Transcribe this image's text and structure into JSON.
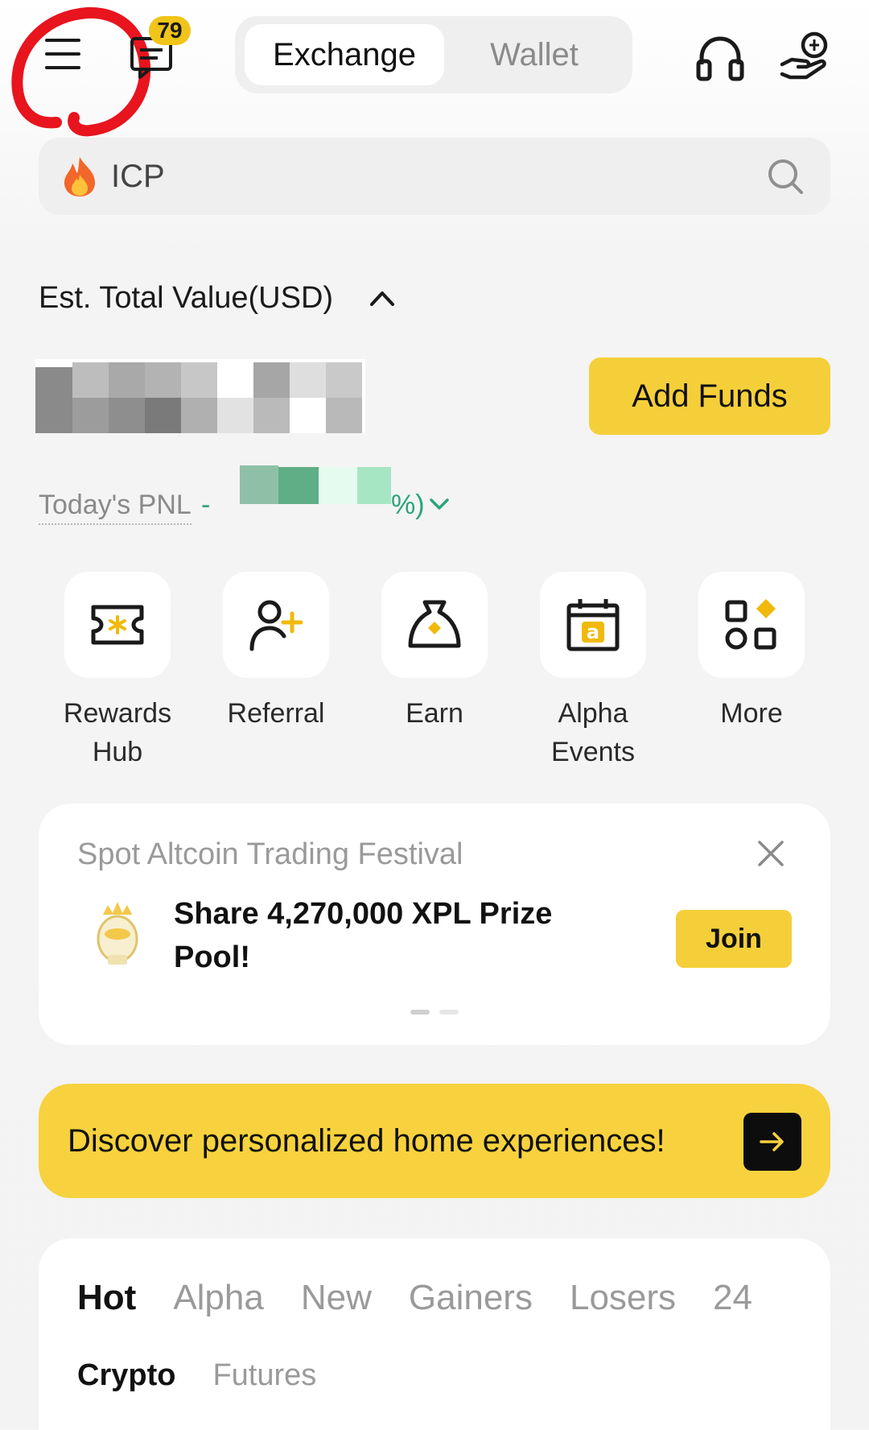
{
  "header": {
    "messages_badge": "79",
    "tabs": [
      {
        "label": "Exchange",
        "active": true
      },
      {
        "label": "Wallet",
        "active": false
      }
    ]
  },
  "search": {
    "placeholder": "ICP",
    "leading_icon": "fire-icon",
    "trailing_icon": "search-icon"
  },
  "portfolio": {
    "total_label": "Est. Total Value(USD)",
    "total_value_hidden": true,
    "add_funds_label": "Add Funds",
    "pnl_label": "Today's PNL",
    "pnl_prefix": "-",
    "pnl_suffix": "%)",
    "pnl_value_hidden": true,
    "pnl_color": "#2aa57a"
  },
  "shortcuts": [
    {
      "label": "Rewards Hub",
      "icon": "ticket-icon"
    },
    {
      "label": "Referral",
      "icon": "add-person-icon"
    },
    {
      "label": "Earn",
      "icon": "money-bag-icon"
    },
    {
      "label": "Alpha Events",
      "icon": "calendar-icon"
    },
    {
      "label": "More",
      "icon": "grid-icon"
    }
  ],
  "promo": {
    "title": "Spot Altcoin Trading Festival",
    "message": "Share 4,270,000 XPL Prize Pool!",
    "join_label": "Join",
    "page_count": 2,
    "current_page": 1
  },
  "discover": {
    "text": "Discover personalized home experiences!"
  },
  "market": {
    "tabs": [
      "Hot",
      "Alpha",
      "New",
      "Gainers",
      "Losers",
      "24"
    ],
    "active_tab": "Hot",
    "sub_tabs": [
      "Crypto",
      "Futures"
    ],
    "active_sub_tab": "Crypto"
  },
  "colors": {
    "accent": "#f5cf3a",
    "annotation": "#e8141e"
  }
}
